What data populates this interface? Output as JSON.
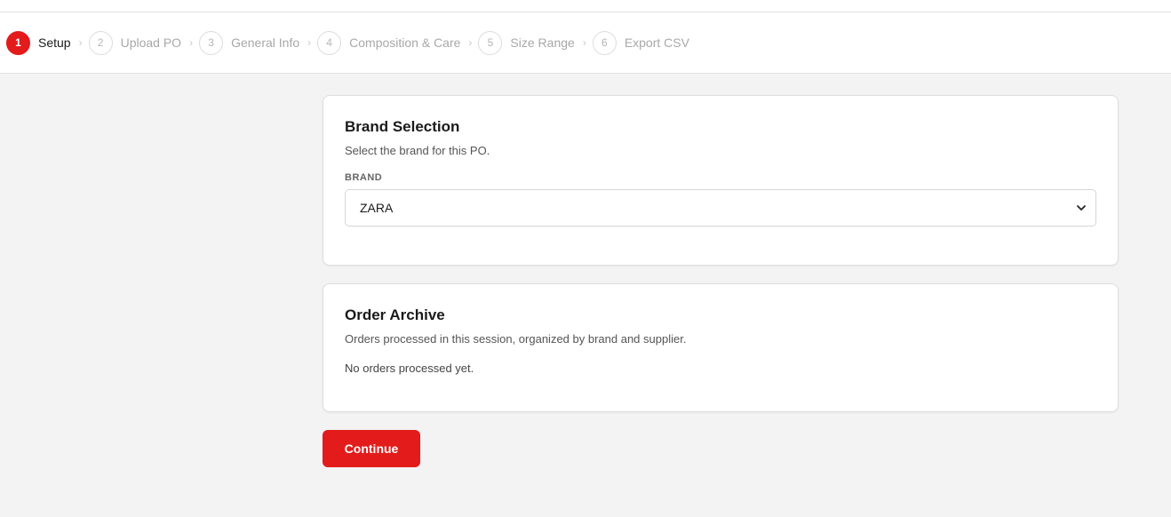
{
  "stepper": {
    "steps": [
      {
        "number": "1",
        "label": "Setup",
        "active": true
      },
      {
        "number": "2",
        "label": "Upload PO",
        "active": false
      },
      {
        "number": "3",
        "label": "General Info",
        "active": false
      },
      {
        "number": "4",
        "label": "Composition & Care",
        "active": false
      },
      {
        "number": "5",
        "label": "Size Range",
        "active": false
      },
      {
        "number": "6",
        "label": "Export CSV",
        "active": false
      }
    ],
    "separator": "›"
  },
  "brand_card": {
    "title": "Brand Selection",
    "description": "Select the brand for this PO.",
    "field_label": "BRAND",
    "selected_value": "ZARA"
  },
  "archive_card": {
    "title": "Order Archive",
    "description": "Orders processed in this session, organized by brand and supplier.",
    "empty_text": "No orders processed yet."
  },
  "actions": {
    "continue_label": "Continue"
  },
  "colors": {
    "accent": "#e31b1b",
    "background": "#f3f3f3"
  }
}
